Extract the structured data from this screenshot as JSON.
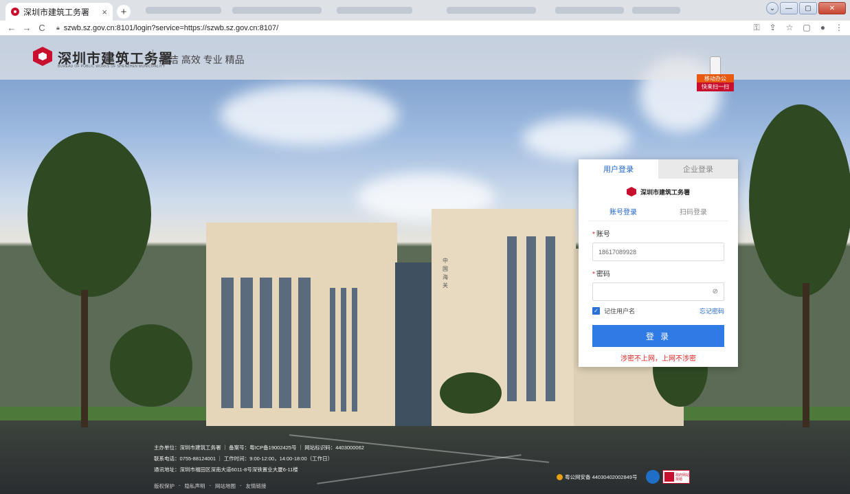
{
  "browser": {
    "active_tab": {
      "title": "深圳市建筑工务署",
      "close": "×"
    },
    "new_tab": "+",
    "url": "szwb.sz.gov.cn:8101/login?service=https://szwb.sz.gov.cn:8107/",
    "nav": {
      "back": "←",
      "forward": "→",
      "reload": "C"
    },
    "addr_icons": {
      "key": "⚿",
      "share": "⇪",
      "star": "☆",
      "sidebar": "▢",
      "profile": "●",
      "menu": "⋮"
    },
    "window": {
      "dropdown": "⌄",
      "minimize": "—",
      "maximize": "▢",
      "close": "✕"
    }
  },
  "header": {
    "site_name": "深圳市建筑工务署",
    "site_name_en": "BUREAU OF PUBLIC WORKS OF SHENZHEN MUNICIPALITY",
    "slogan": "廉洁 高效 专业 精品"
  },
  "mobile_badge": {
    "line1": "移动办公",
    "line2": "快来扫一扫"
  },
  "building_sign": "中国海关",
  "login": {
    "tab_user": "用户登录",
    "tab_enterprise": "企业登录",
    "panel_logo": "深圳市建筑工务署",
    "subtab_account": "账号登录",
    "subtab_qr": "扫码登录",
    "account_label": "账号",
    "account_value": "18617089928",
    "password_label": "密码",
    "password_value": "",
    "required_mark": "*",
    "remember": "记住用户名",
    "remember_check": "✓",
    "forgot": "忘记密码",
    "submit": "登 录",
    "warning": "涉密不上网，上网不涉密",
    "eye_icon": "⊘"
  },
  "footer": {
    "line1": "主办单位：深圳市建筑工务署 ｜ 备案号：粤ICP备19002425号 ｜ 网站标识码：4403000062",
    "line2": "联系电话：0755-88124001 ｜ 工作时间：9:00-12:00，14:00-18:00（工作日）",
    "line3": "通讯地址：深圳市福田区深南大道6011-8号深铁置业大厦6-11楼",
    "links": [
      "版权保护",
      "隐私声明",
      "网站地图",
      "友情链接"
    ],
    "beian": "粤公网安备 44030402002849号",
    "gov_badge_text": "政府网站\n找错"
  }
}
